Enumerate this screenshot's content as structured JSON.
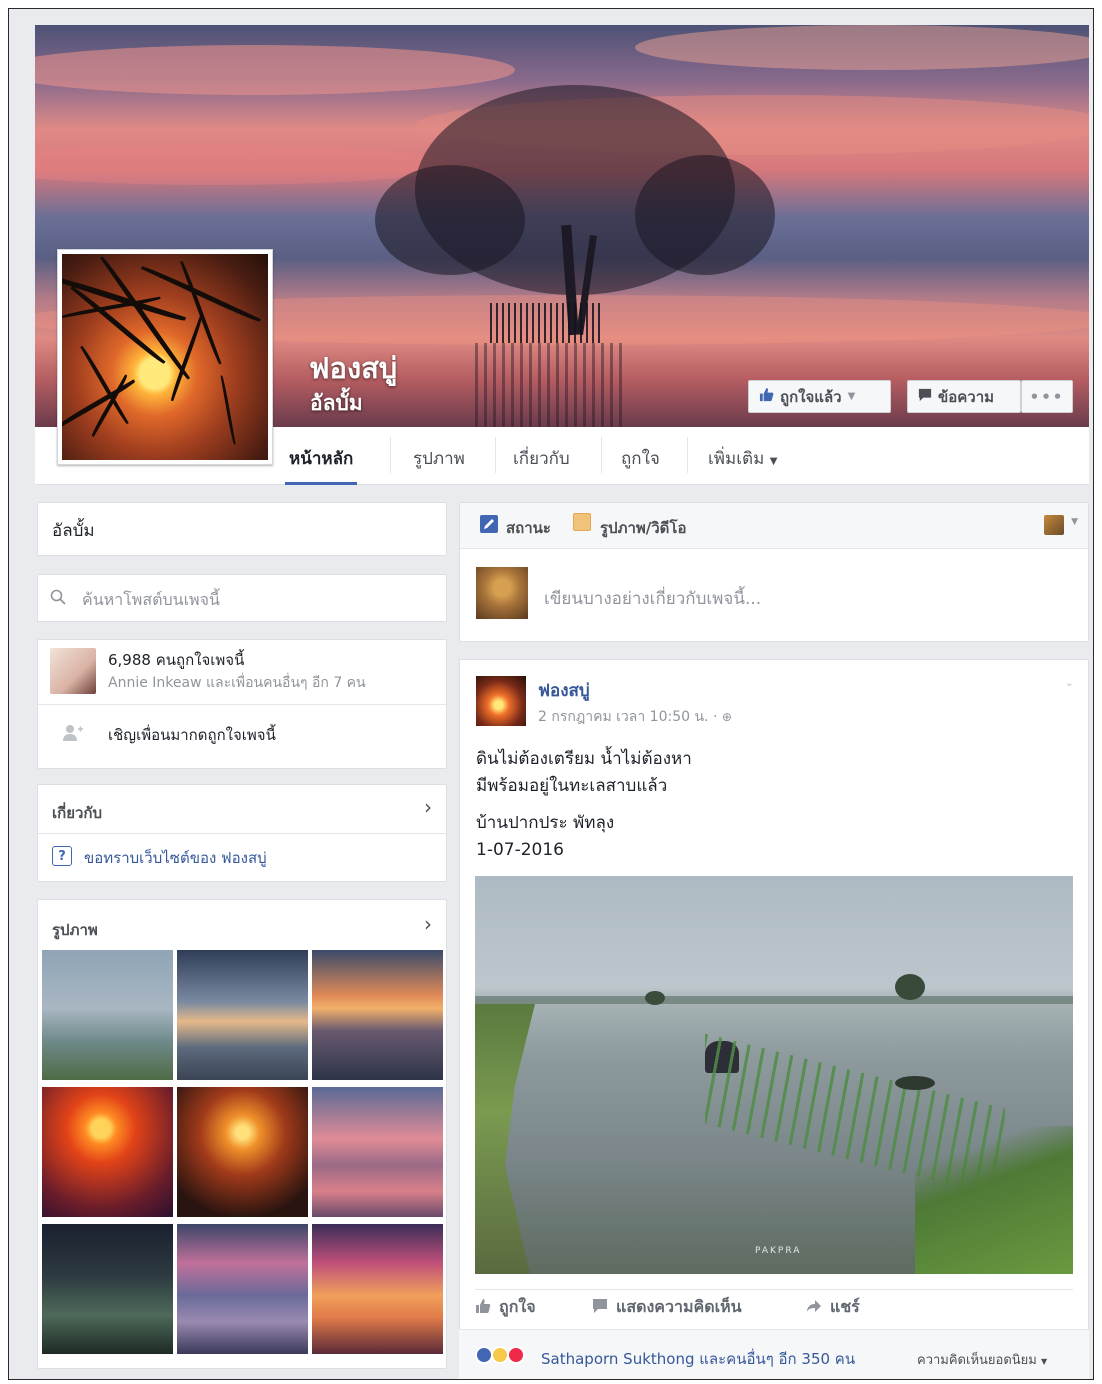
{
  "page": {
    "name": "ฟองสบู่",
    "category": "อัลบั้ม"
  },
  "cover_actions": {
    "liked_label": "ถูกใจแล้ว",
    "message_label": "ข้อความ",
    "more_label": "•••"
  },
  "tabs": [
    {
      "label": "หน้าหลัก",
      "active": true
    },
    {
      "label": "รูปภาพ"
    },
    {
      "label": "เกี่ยวกับ"
    },
    {
      "label": "ถูกใจ"
    },
    {
      "label": "เพิ่มเติม",
      "dropdown": true
    }
  ],
  "sidebar": {
    "category_label": "อัลบั้ม",
    "search_placeholder": "ค้นหาโพสต์บนเพจนี้",
    "likes_count": "6,988 คนถูกใจเพจนี้",
    "likes_friends": "Annie Inkeaw และเพื่อนคนอื่นๆ อีก 7 คน",
    "invite_label": "เชิญเพื่อนมากดถูกใจเพจนี้",
    "about_header": "เกี่ยวกับ",
    "ask_website": "ขอทราบเว็บไซต์ของ ฟองสบู่",
    "photos_header": "รูปภาพ"
  },
  "composer": {
    "status_label": "สถานะ",
    "photo_video_label": "รูปภาพ/วิดีโอ",
    "placeholder": "เขียนบางอย่างเกี่ยวกับเพจนี้..."
  },
  "post": {
    "author": "ฟองสบู่",
    "timestamp": "2 กรกฎาคม เวลา 10:50 น. · ",
    "text_line1": "ดินไม่ต้องเตรียม น้ำไม่ต้องหา",
    "text_line2": "มีพร้อมอยู่ในทะเลสาบแล้ว",
    "text_line3": "บ้านปากประ พัทลุง",
    "text_line4": "1-07-2016",
    "watermark": "PAKPRA",
    "like_label": "ถูกใจ",
    "comment_label": "แสดงความคิดเห็น",
    "share_label": "แชร์",
    "reactions_text": "Sathaporn Sukthong และคนอื่นๆ อีก 350 คน",
    "top_comments_label": "ความคิดเห็นยอดนิยม"
  },
  "colors": {
    "link_blue": "#365899",
    "fb_blue": "#4267b2",
    "background": "#e9ebee"
  },
  "icons": [
    "thumbs-up-icon",
    "message-icon",
    "more-icon",
    "search-icon",
    "add-friend-icon",
    "question-icon",
    "chevron-right-icon",
    "status-icon",
    "photo-icon",
    "globe-icon",
    "comment-icon",
    "share-icon",
    "like-reaction-icon",
    "wow-reaction-icon",
    "love-reaction-icon"
  ]
}
